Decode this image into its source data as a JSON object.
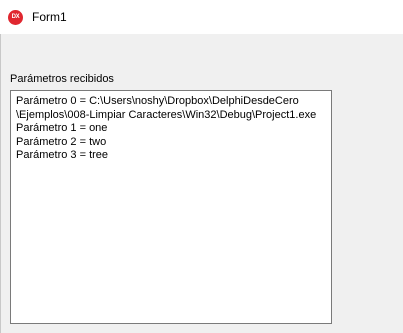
{
  "window": {
    "title": "Form1",
    "icon_text": "DX"
  },
  "form": {
    "label": "Parámetros recibidos",
    "memo_lines": [
      "Parámetro 0 = C:\\Users\\noshy\\Dropbox\\DelphiDesdeCero",
      "\\Ejemplos\\008-Limpiar Caracteres\\Win32\\Debug\\Project1.exe",
      "Parámetro 1 = one",
      "Parámetro 2 = two",
      "Parámetro 3 = tree"
    ]
  }
}
